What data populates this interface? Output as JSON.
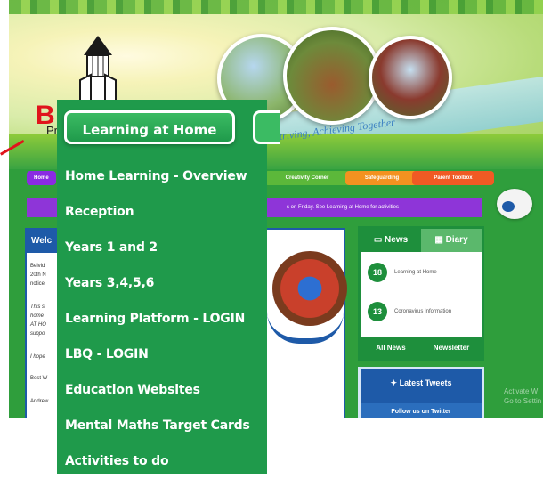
{
  "header": {
    "logo_initial": "B",
    "logo_fragment": "Pr",
    "tagline": "ping, Striving, Achieving Together"
  },
  "nav": {
    "home": "Home",
    "creativity": "Creativity Corner",
    "safeguarding": "Safeguarding",
    "parent_toolbox": "Parent Toolbox"
  },
  "ticker": {
    "text": "s on Friday.    See Learning at Home for activities"
  },
  "welcome_panel": {
    "title": "Welc",
    "lines": [
      "Belvid",
      "20th N",
      "notice",
      "This s",
      "home",
      "AT HO",
      "suppo",
      "I hope",
      "Best W",
      "Andrew"
    ]
  },
  "news": {
    "tab_news": "News",
    "tab_diary": "Diary",
    "items": [
      {
        "day": "18",
        "month": "MAR",
        "title": "Learning at Home"
      },
      {
        "day": "13",
        "month": "MAR",
        "title": "Coronavirus Information"
      }
    ],
    "all_news": "All News",
    "newsletter": "Newsletter"
  },
  "tweets": {
    "title": "Latest Tweets",
    "follow": "Follow us on Twitter"
  },
  "watermark": {
    "line1": "Activate W",
    "line2": "Go to Settin"
  },
  "menu": {
    "button": "Learning at Home",
    "items": [
      "Home Learning - Overview",
      "Reception",
      "Years 1 and 2",
      "Years 3,4,5,6",
      "Learning Platform - LOGIN",
      "LBQ - LOGIN",
      "Education Websites",
      "Mental Maths Target Cards",
      "Activities to do"
    ]
  },
  "colors": {
    "menu_green": "#1f9a4b",
    "brand_blue": "#1e5aa8",
    "ticker_purple": "#8e35d8"
  }
}
